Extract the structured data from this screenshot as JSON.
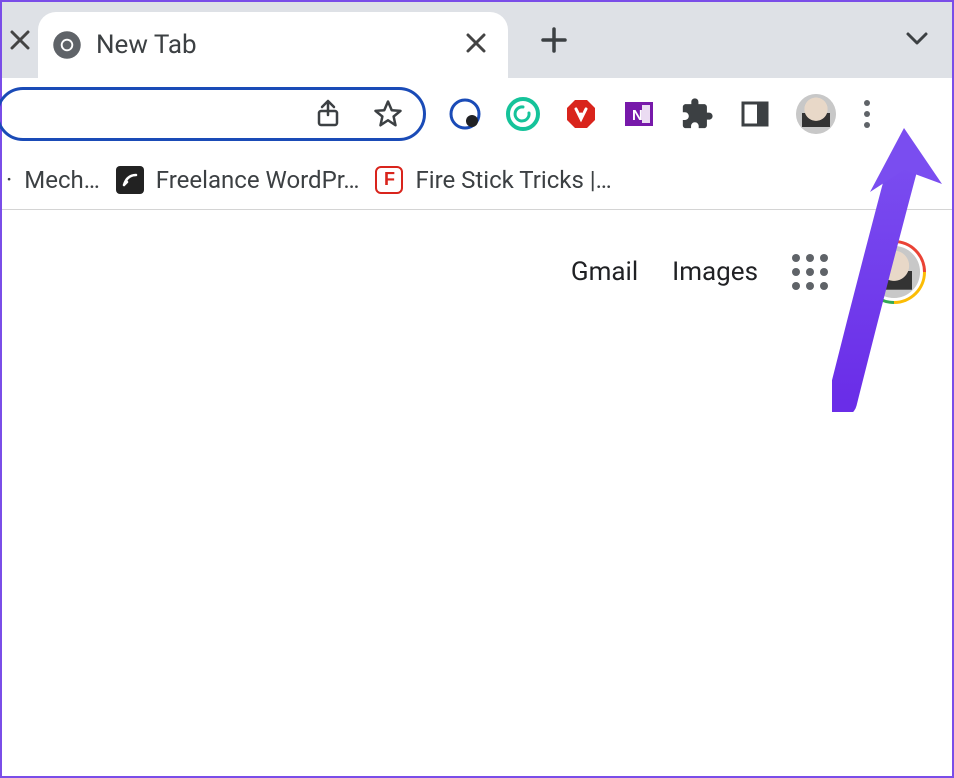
{
  "tab": {
    "title": "New Tab"
  },
  "bookmarks": [
    {
      "label": "Mech…"
    },
    {
      "label": "Freelance WordPr…"
    },
    {
      "label": "Fire Stick Tricks |…"
    }
  ],
  "ntp": {
    "gmail": "Gmail",
    "images": "Images"
  }
}
